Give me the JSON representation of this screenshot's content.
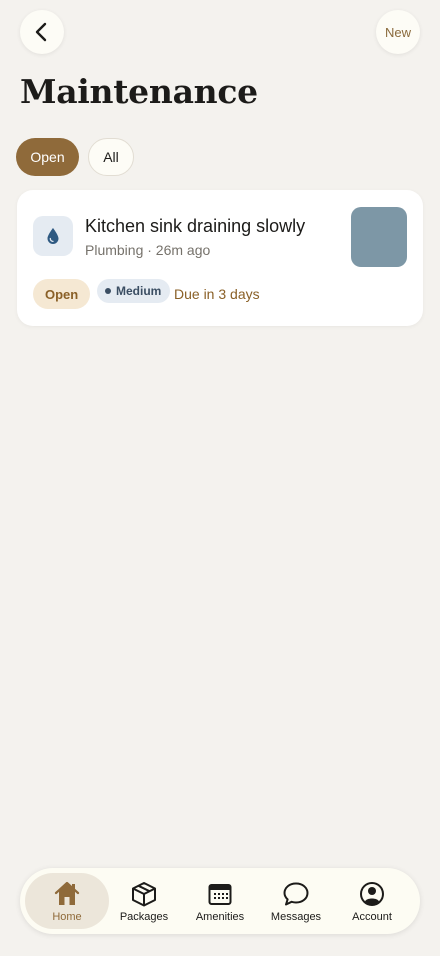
{
  "header": {
    "new_label": "New",
    "title": "Maintenance"
  },
  "filters": [
    {
      "label": "Open",
      "active": true
    },
    {
      "label": "All",
      "active": false
    }
  ],
  "requests": [
    {
      "title": "Kitchen sink draining slowly",
      "meta": "Plumbing · 26m ago",
      "category_icon": "water-drop-icon",
      "status": "Open",
      "priority": "Medium",
      "due": "Due in 3 days",
      "thumbnail_color": "#7d97a6"
    }
  ],
  "tabbar": {
    "items": [
      {
        "label": "Home",
        "icon": "home-icon",
        "active": true
      },
      {
        "label": "Packages",
        "icon": "package-icon",
        "active": false
      },
      {
        "label": "Amenities",
        "icon": "calendar-icon",
        "active": false
      },
      {
        "label": "Messages",
        "icon": "chat-bubble-icon",
        "active": false
      },
      {
        "label": "Account",
        "icon": "user-circle-icon",
        "active": false
      }
    ]
  },
  "colors": {
    "background": "#f4f2ee",
    "accent": "#8f6a3a",
    "card": "#ffffff",
    "priority_bg": "#e5ebf2",
    "status_bg": "#f5e8d3"
  }
}
